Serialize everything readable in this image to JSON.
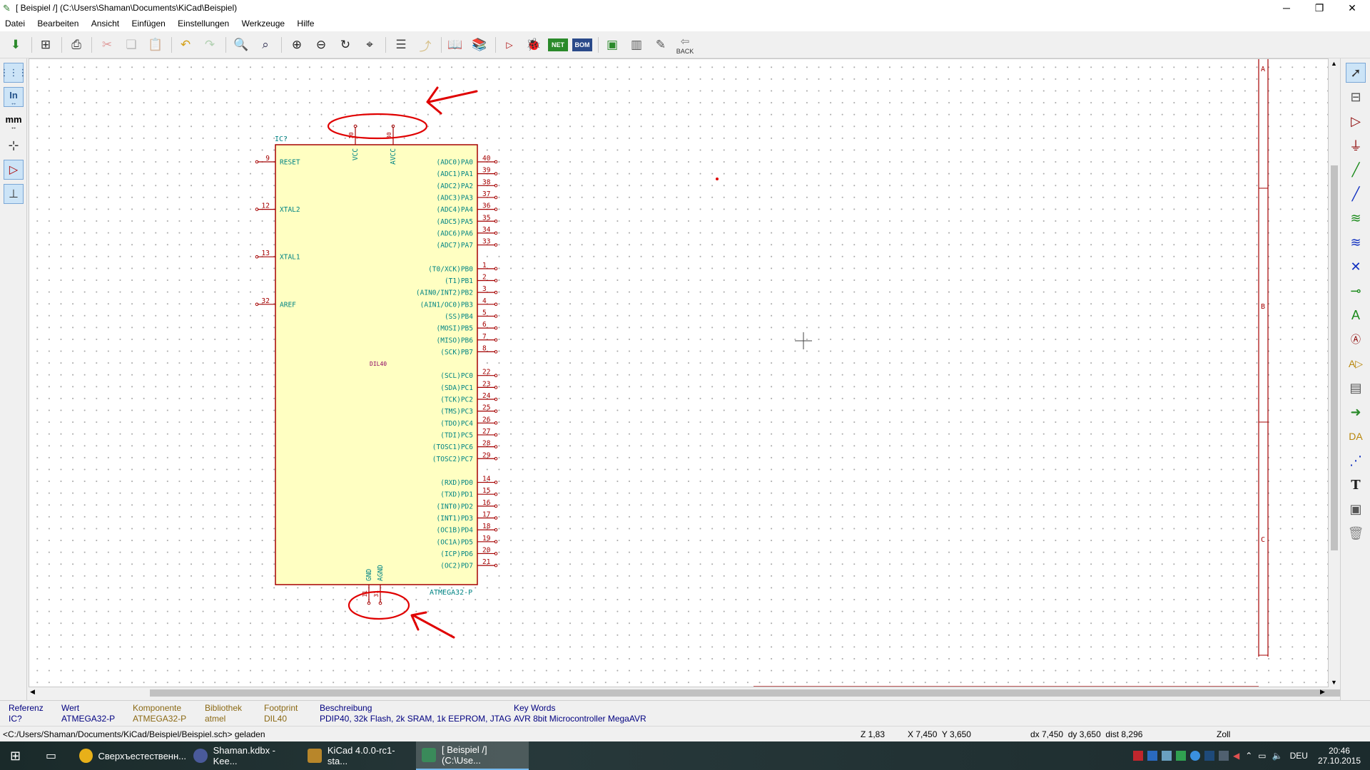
{
  "window": {
    "title": "[ Beispiel /] (C:\\Users\\Shaman\\Documents\\KiCad\\Beispiel)",
    "minimize": "─",
    "restore": "❐",
    "close": "✕"
  },
  "menu": [
    "Datei",
    "Bearbeiten",
    "Ansicht",
    "Einfügen",
    "Einstellungen",
    "Werkzeuge",
    "Hilfe"
  ],
  "toolbar": {
    "back_label": "BACK"
  },
  "left_tools": {
    "units_in": "In",
    "units_mm": "mm"
  },
  "schematic": {
    "reference": "IC?",
    "value": "ATMEGA32-P",
    "footprint_label": "DIL40",
    "top_pins": [
      {
        "name": "VCC",
        "num": "10"
      },
      {
        "name": "AVCC",
        "num": "30"
      }
    ],
    "bottom_pins": [
      {
        "name": "GND",
        "num": "11"
      },
      {
        "name": "AGND",
        "num": "31"
      }
    ],
    "left_pins": [
      {
        "name": "RESET",
        "num": "9"
      },
      {
        "name": "XTAL2",
        "num": "12"
      },
      {
        "name": "XTAL1",
        "num": "13"
      },
      {
        "name": "AREF",
        "num": "32"
      }
    ],
    "right_pins": [
      {
        "name": "(ADC0)PA0",
        "num": "40"
      },
      {
        "name": "(ADC1)PA1",
        "num": "39"
      },
      {
        "name": "(ADC2)PA2",
        "num": "38"
      },
      {
        "name": "(ADC3)PA3",
        "num": "37"
      },
      {
        "name": "(ADC4)PA4",
        "num": "36"
      },
      {
        "name": "(ADC5)PA5",
        "num": "35"
      },
      {
        "name": "(ADC6)PA6",
        "num": "34"
      },
      {
        "name": "(ADC7)PA7",
        "num": "33"
      },
      {
        "name": "(T0/XCK)PB0",
        "num": "1"
      },
      {
        "name": "(T1)PB1",
        "num": "2"
      },
      {
        "name": "(AIN0/INT2)PB2",
        "num": "3"
      },
      {
        "name": "(AIN1/OC0)PB3",
        "num": "4"
      },
      {
        "name": "(SS)PB4",
        "num": "5"
      },
      {
        "name": "(MOSI)PB5",
        "num": "6"
      },
      {
        "name": "(MISO)PB6",
        "num": "7"
      },
      {
        "name": "(SCK)PB7",
        "num": "8"
      },
      {
        "name": "(SCL)PC0",
        "num": "22"
      },
      {
        "name": "(SDA)PC1",
        "num": "23"
      },
      {
        "name": "(TCK)PC2",
        "num": "24"
      },
      {
        "name": "(TMS)PC3",
        "num": "25"
      },
      {
        "name": "(TDO)PC4",
        "num": "26"
      },
      {
        "name": "(TDI)PC5",
        "num": "27"
      },
      {
        "name": "(TOSC1)PC6",
        "num": "28"
      },
      {
        "name": "(TOSC2)PC7",
        "num": "29"
      },
      {
        "name": "(RXD)PD0",
        "num": "14"
      },
      {
        "name": "(TXD)PD1",
        "num": "15"
      },
      {
        "name": "(INT0)PD2",
        "num": "16"
      },
      {
        "name": "(INT1)PD3",
        "num": "17"
      },
      {
        "name": "(OC1B)PD4",
        "num": "18"
      },
      {
        "name": "(OC1A)PD5",
        "num": "19"
      },
      {
        "name": "(ICP)PD6",
        "num": "20"
      },
      {
        "name": "(OC2)PD7",
        "num": "21"
      }
    ],
    "border_labels": [
      "A",
      "B",
      "C"
    ]
  },
  "infobar": {
    "columns": [
      {
        "header": "Referenz",
        "value": "IC?"
      },
      {
        "header": "Wert",
        "value": "ATMEGA32-P"
      },
      {
        "header": "Komponente",
        "value": "ATMEGA32-P"
      },
      {
        "header": "Bibliothek",
        "value": "atmel"
      },
      {
        "header": "Footprint",
        "value": "DIL40"
      },
      {
        "header": "Beschreibung",
        "value": "PDIP40, 32k Flash, 2k SRAM, 1k EEPROM, JTAG"
      },
      {
        "header": "Key Words",
        "value": "AVR 8bit Microcontroller MegaAVR"
      }
    ]
  },
  "status": {
    "message": "<C:/Users/Shaman/Documents/KiCad/Beispiel/Beispiel.sch> geladen",
    "zoom": "Z 1,83",
    "xy": "X 7,450  Y 3,650",
    "delta": "dx 7,450  dy 3,650  dist 8,296",
    "units": "Zoll"
  },
  "taskbar": {
    "items": [
      {
        "label": "Сверхъестественн...",
        "icon_color": "#e8b019"
      },
      {
        "label": "Shaman.kdbx - Kee...",
        "icon_color": "#4a5a9a"
      },
      {
        "label": "KiCad 4.0.0-rc1-sta...",
        "icon_color": "#b8862a"
      },
      {
        "label": "[ Beispiel /] (C:\\Use...",
        "icon_color": "#3a8a5a"
      }
    ],
    "language": "DEU",
    "time": "20:46",
    "date": "27.10.2015"
  },
  "colors": {
    "schematic_red": "#a50000",
    "pin_text": "#008484",
    "body_fill": "#ffffc2",
    "annotation_red": "#e00000"
  }
}
